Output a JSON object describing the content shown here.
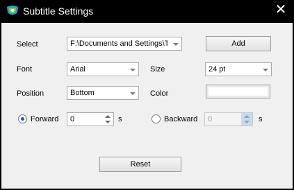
{
  "window": {
    "title": "Subtitle Settings",
    "close_glyph": "✕"
  },
  "select": {
    "label": "Select",
    "value": "F:\\Documents and Settings\\Th",
    "add_label": "Add"
  },
  "font": {
    "label": "Font",
    "value": "Arial"
  },
  "size": {
    "label": "Size",
    "value": "24 pt"
  },
  "position": {
    "label": "Position",
    "value": "Bottom"
  },
  "color": {
    "label": "Color",
    "value": "#ffffff"
  },
  "forward": {
    "label": "Forward",
    "value": "0",
    "unit": "s",
    "selected": true
  },
  "backward": {
    "label": "Backward",
    "value": "0",
    "unit": "s",
    "selected": false
  },
  "reset": {
    "label": "Reset"
  },
  "icons": {
    "app": "app-logo-icon",
    "close": "close-icon"
  }
}
